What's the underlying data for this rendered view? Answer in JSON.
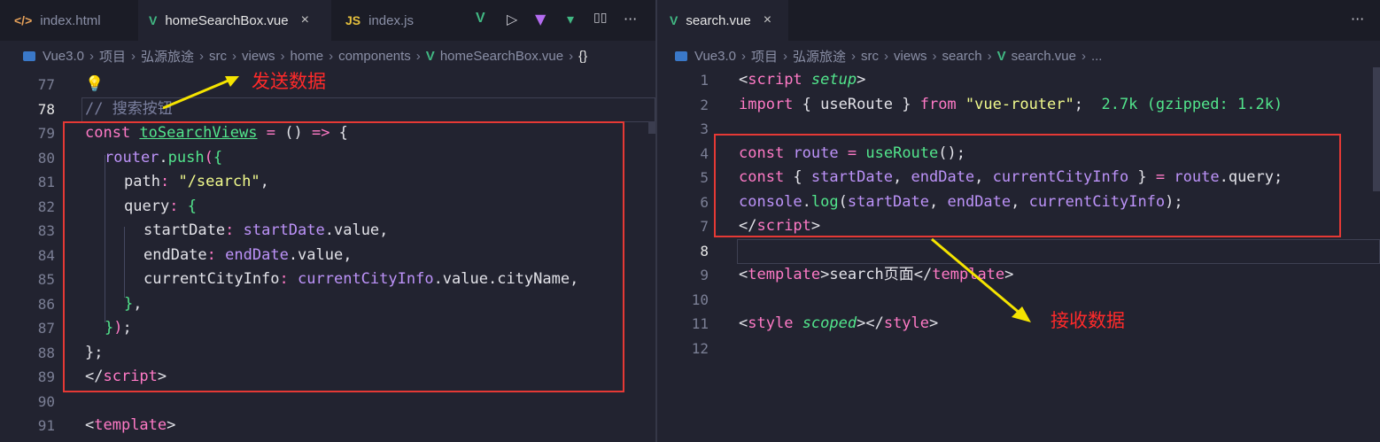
{
  "left": {
    "tabs": [
      {
        "icon": "</>",
        "label": "index.html"
      },
      {
        "icon": "V",
        "label": "homeSearchBox.vue"
      },
      {
        "icon": "JS",
        "label": "index.js"
      }
    ],
    "tab_close": "×",
    "breadcrumb": [
      "Vue3.0",
      "项目",
      "弘源旅途",
      "src",
      "views",
      "home",
      "components",
      "homeSearchBox.vue",
      "{}"
    ],
    "lines": [
      {
        "n": "77"
      },
      {
        "n": "78"
      },
      {
        "n": "79"
      },
      {
        "n": "80"
      },
      {
        "n": "81"
      },
      {
        "n": "82"
      },
      {
        "n": "83"
      },
      {
        "n": "84"
      },
      {
        "n": "85"
      },
      {
        "n": "86"
      },
      {
        "n": "87"
      },
      {
        "n": "88"
      },
      {
        "n": "89"
      },
      {
        "n": "90"
      },
      {
        "n": "91"
      }
    ],
    "annotation": "发送数据"
  },
  "right": {
    "tab": {
      "icon": "V",
      "label": "search.vue"
    },
    "tab_close": "×",
    "breadcrumb": [
      "Vue3.0",
      "项目",
      "弘源旅途",
      "src",
      "views",
      "search",
      "search.vue",
      "..."
    ],
    "lines": [
      {
        "n": "1"
      },
      {
        "n": "2"
      },
      {
        "n": "3"
      },
      {
        "n": "4"
      },
      {
        "n": "5"
      },
      {
        "n": "6"
      },
      {
        "n": "7"
      },
      {
        "n": "8"
      },
      {
        "n": "9"
      },
      {
        "n": "10"
      },
      {
        "n": "11"
      },
      {
        "n": "12"
      }
    ],
    "annotation": "接收数据"
  },
  "toolbar": {
    "run": "▷",
    "more": "···",
    "split": "▯▯"
  },
  "colors": {
    "accent": "#e53935",
    "vue": "#41b883",
    "keyword": "#ff7ac6",
    "function": "#52e58c",
    "string": "#f1fa8c",
    "variable": "#bd93f9"
  }
}
